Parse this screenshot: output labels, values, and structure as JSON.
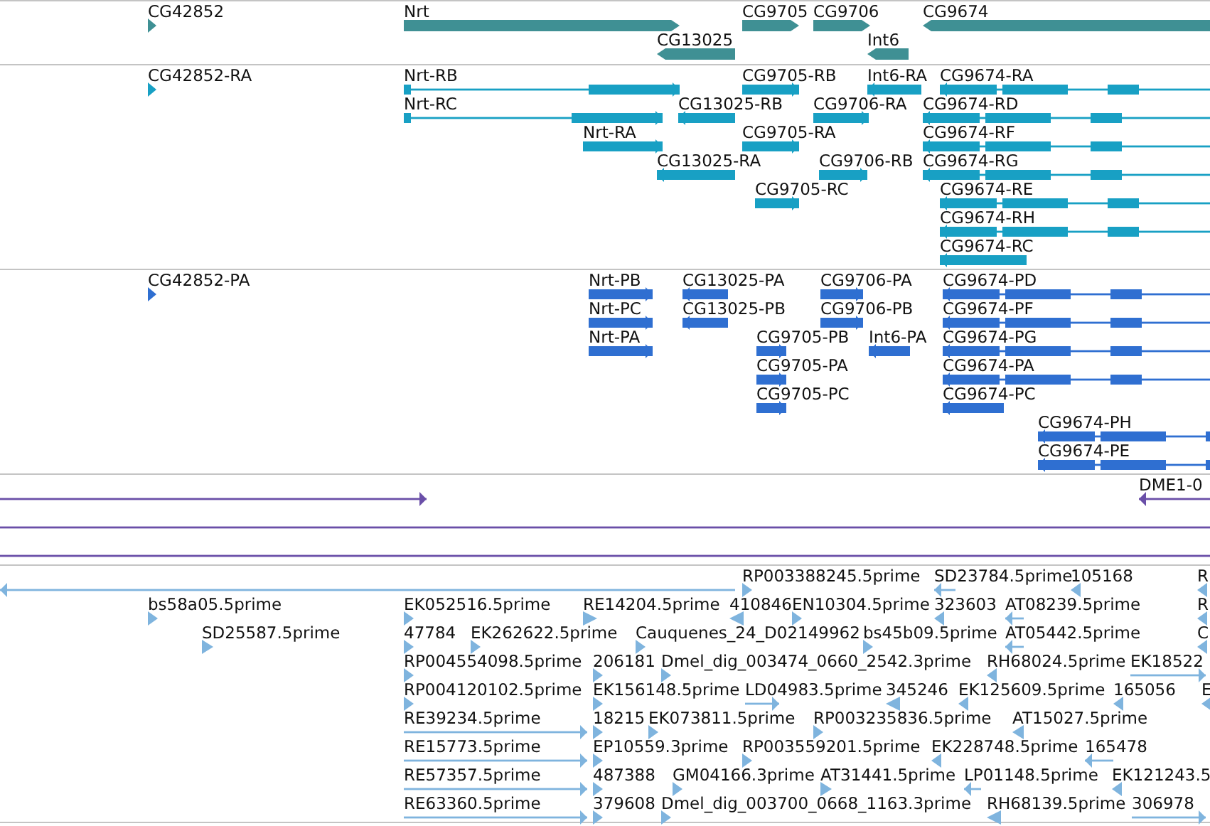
{
  "tracks": [
    {
      "kind": "gene",
      "color": "#3f9094",
      "features": [
        {
          "label": "CG42852",
          "reverse": false
        },
        {
          "label": "Nrt",
          "reverse": false
        },
        {
          "label": "CG9705",
          "reverse": false
        },
        {
          "label": "CG9706",
          "reverse": false
        },
        {
          "label": "CG9674",
          "reverse": true
        },
        {
          "label": "CG13025",
          "reverse": true
        },
        {
          "label": "Int6",
          "reverse": true
        }
      ]
    },
    {
      "kind": "transcript",
      "color": "#18a0c4",
      "features": [
        {
          "label": "CG42852-RA",
          "reverse": false
        },
        {
          "label": "Nrt-RB",
          "reverse": false
        },
        {
          "label": "CG9705-RB",
          "reverse": false
        },
        {
          "label": "Int6-RA",
          "reverse": true
        },
        {
          "label": "CG9674-RA",
          "reverse": true
        },
        {
          "label": "Nrt-RC",
          "reverse": false
        },
        {
          "label": "CG13025-RB",
          "reverse": true
        },
        {
          "label": "CG9706-RA",
          "reverse": false
        },
        {
          "label": "CG9674-RD",
          "reverse": true
        },
        {
          "label": "Nrt-RA",
          "reverse": false
        },
        {
          "label": "CG9705-RA",
          "reverse": false
        },
        {
          "label": "CG9674-RF",
          "reverse": true
        },
        {
          "label": "CG13025-RA",
          "reverse": true
        },
        {
          "label": "CG9706-RB",
          "reverse": false
        },
        {
          "label": "CG9674-RG",
          "reverse": true
        },
        {
          "label": "CG9705-RC",
          "reverse": false
        },
        {
          "label": "CG9674-RE",
          "reverse": true
        },
        {
          "label": "CG9674-RH",
          "reverse": true
        },
        {
          "label": "CG9674-RC",
          "reverse": true
        }
      ]
    },
    {
      "kind": "transcript",
      "color": "#2f6fd1",
      "features": [
        {
          "label": "CG42852-PA",
          "reverse": false
        },
        {
          "label": "Nrt-PB",
          "reverse": false
        },
        {
          "label": "CG13025-PA",
          "reverse": true
        },
        {
          "label": "CG9706-PA",
          "reverse": false
        },
        {
          "label": "CG9674-PD",
          "reverse": true
        },
        {
          "label": "Nrt-PC",
          "reverse": false
        },
        {
          "label": "CG13025-PB",
          "reverse": true
        },
        {
          "label": "CG9706-PB",
          "reverse": false
        },
        {
          "label": "CG9674-PF",
          "reverse": true
        },
        {
          "label": "Nrt-PA",
          "reverse": false
        },
        {
          "label": "CG9705-PB",
          "reverse": false
        },
        {
          "label": "Int6-PA",
          "reverse": true
        },
        {
          "label": "CG9674-PG",
          "reverse": true
        },
        {
          "label": "CG9705-PA",
          "reverse": false
        },
        {
          "label": "CG9674-PA",
          "reverse": true
        },
        {
          "label": "CG9705-PC",
          "reverse": false
        },
        {
          "label": "CG9674-PC",
          "reverse": true
        },
        {
          "label": "CG9674-PH",
          "reverse": true
        },
        {
          "label": "CG9674-PE",
          "reverse": true
        }
      ]
    },
    {
      "kind": "match",
      "color": "#6a4fa8",
      "features": [
        {
          "reverse": false
        },
        {
          "label": "DME1-0",
          "reverse": true
        },
        {
          "clipped": true
        },
        {
          "clipped": true
        }
      ]
    },
    {
      "kind": "match",
      "color": "#7fb4de",
      "features": [
        {
          "reverse": true
        },
        {
          "label": "RP003388245.5prime",
          "reverse": false
        },
        {
          "label": "SD23784.5prime",
          "reverse": true
        },
        {
          "label": "105168",
          "reverse": true
        },
        {
          "label": "R",
          "reverse": true
        },
        {
          "label": "bs58a05.5prime",
          "reverse": false
        },
        {
          "label": "EK052516.5prime",
          "reverse": false
        },
        {
          "label": "RE14204.5prime",
          "reverse": false
        },
        {
          "label": "410846",
          "reverse": true
        },
        {
          "label": "EN10304.5prime",
          "reverse": false
        },
        {
          "label": "323603",
          "reverse": true
        },
        {
          "label": "AT08239.5prime",
          "reverse": true
        },
        {
          "label": "R",
          "reverse": true
        },
        {
          "label": "SD25587.5prime",
          "reverse": false
        },
        {
          "label": "47784",
          "reverse": false
        },
        {
          "label": "EK262622.5prime",
          "reverse": false
        },
        {
          "label": "Cauquenes_24_D02149962",
          "reverse": false
        },
        {
          "label": "bs45b09.5prime",
          "reverse": false
        },
        {
          "label": "AT05442.5prime",
          "reverse": true
        },
        {
          "label": "C",
          "reverse": true
        },
        {
          "label": "RP004554098.5prime",
          "reverse": false
        },
        {
          "label": "206181",
          "reverse": false
        },
        {
          "label": "Dmel_dig_003474_0660_2542.3prime",
          "reverse": false
        },
        {
          "label": "RH68024.5prime",
          "reverse": true
        },
        {
          "label": "EK18522",
          "reverse": false
        },
        {
          "label": "RP004120102.5prime",
          "reverse": false
        },
        {
          "label": "EK156148.5prime",
          "reverse": false
        },
        {
          "label": "LD04983.5prime",
          "reverse": false
        },
        {
          "label": "345246",
          "reverse": true
        },
        {
          "label": "EK125609.5prime",
          "reverse": true
        },
        {
          "label": "165056",
          "reverse": true
        },
        {
          "label": "E",
          "reverse": true
        },
        {
          "label": "RE39234.5prime",
          "reverse": false
        },
        {
          "label": "18215",
          "reverse": false
        },
        {
          "label": "EK073811.5prime",
          "reverse": false
        },
        {
          "label": "RP003235836.5prime",
          "reverse": false
        },
        {
          "label": "AT15027.5prime",
          "reverse": true
        },
        {
          "label": "RE15773.5prime",
          "reverse": false
        },
        {
          "label": "EP10559.3prime",
          "reverse": false
        },
        {
          "label": "RP003559201.5prime",
          "reverse": false
        },
        {
          "label": "EK228748.5prime",
          "reverse": true
        },
        {
          "label": "165478",
          "reverse": true
        },
        {
          "label": "RE57357.5prime",
          "reverse": false
        },
        {
          "label": "487388",
          "reverse": false
        },
        {
          "label": "GM04166.3prime",
          "reverse": false
        },
        {
          "label": "AT31441.5prime",
          "reverse": false
        },
        {
          "label": "LP01148.5prime",
          "reverse": true
        },
        {
          "label": "EK121243.5",
          "reverse": true
        },
        {
          "label": "RE63360.5prime",
          "reverse": false
        },
        {
          "label": "379608",
          "reverse": false
        },
        {
          "label": "Dmel_dig_003700_0668_1163.3prime",
          "reverse": false
        },
        {
          "label": "RH68139.5prime",
          "reverse": true
        },
        {
          "label": "306978",
          "reverse": false
        }
      ]
    }
  ]
}
